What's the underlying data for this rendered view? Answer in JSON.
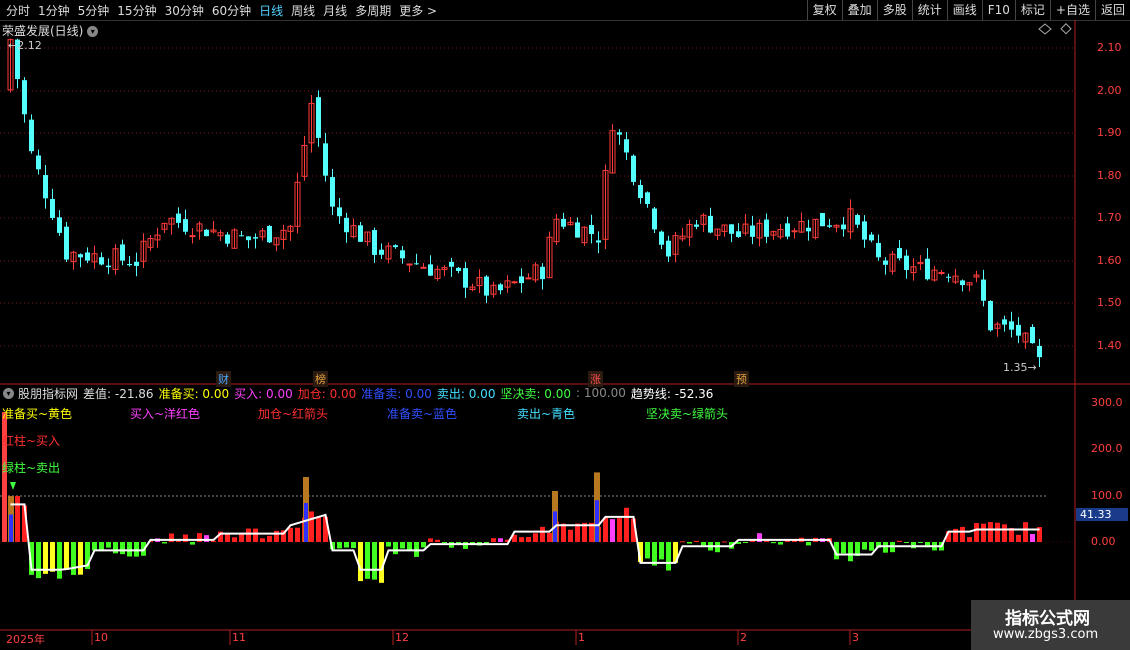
{
  "toolbar": {
    "periods": [
      "分时",
      "1分钟",
      "5分钟",
      "15分钟",
      "30分钟",
      "60分钟",
      "日线",
      "周线",
      "月线",
      "多周期",
      "更多 >"
    ],
    "active_period": "日线",
    "right_buttons": [
      "复权",
      "叠加",
      "多股",
      "统计",
      "画线",
      "F10",
      "标记",
      "+自选",
      "返回"
    ]
  },
  "main_chart": {
    "title": "荣盛发展(日线)",
    "high_label": "2.12",
    "low_label": "1.35",
    "y_ticks": [
      "2.10",
      "2.00",
      "1.90",
      "1.80",
      "1.70",
      "1.60",
      "1.50",
      "1.40"
    ],
    "event_tags": [
      {
        "text": "财",
        "color": "#4aa8ff"
      },
      {
        "text": "榜",
        "color": "#e0a040"
      },
      {
        "text": "涨",
        "color": "#ff5050"
      },
      {
        "text": "预",
        "color": "#e0a040"
      }
    ]
  },
  "indicator": {
    "name": "股朋指标网",
    "values": [
      {
        "label": "差值: -21.86",
        "color": "#dddddd"
      },
      {
        "label": "准备买: 0.00",
        "color": "#ffff00"
      },
      {
        "label": "买入: 0.00",
        "color": "#ff40ff"
      },
      {
        "label": "加仓: 0.00",
        "color": "#ff3030"
      },
      {
        "label": "准备卖: 0.00",
        "color": "#3050ff"
      },
      {
        "label": "卖出: 0.00",
        "color": "#40e0ff"
      },
      {
        "label": "坚决卖: 0.00",
        "color": "#40ff40"
      },
      {
        "label": ": 100.00",
        "color": "#888888"
      },
      {
        "label": "趋势线: -52.36",
        "color": "#ffffff"
      }
    ],
    "legend": [
      {
        "text": "准备买~黄色",
        "color": "#ffff00"
      },
      {
        "text": "买入~洋红色",
        "color": "#ff40ff"
      },
      {
        "text": "加仓~红箭头",
        "color": "#ff3030"
      },
      {
        "text": "准备卖~蓝色",
        "color": "#3050ff"
      },
      {
        "text": "卖出~青色",
        "color": "#40e0ff"
      },
      {
        "text": "坚决卖~绿箭头",
        "color": "#40ff40"
      },
      {
        "text": "红柱~买入",
        "color": "#ff3030"
      },
      {
        "text": "绿柱~卖出",
        "color": "#40ff40"
      }
    ],
    "y_ticks": [
      "300.0",
      "200.0",
      "100.0",
      "0.00"
    ],
    "current_value": "41.33"
  },
  "date_axis": [
    "2025年",
    "10",
    "11",
    "12",
    "1",
    "2",
    "3"
  ],
  "watermark": {
    "line1": "指标公式网",
    "line2": "www.zbgs3.com"
  }
}
